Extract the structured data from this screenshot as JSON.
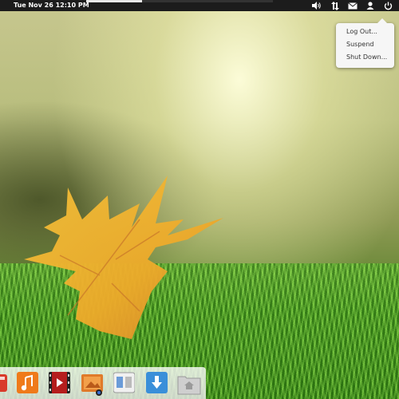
{
  "panel": {
    "clock_text": "Tue Nov 26 12:10 PM",
    "progress": 0.3,
    "indicators": [
      {
        "icon": "volume-icon"
      },
      {
        "icon": "network-icon"
      },
      {
        "icon": "mail-icon"
      },
      {
        "icon": "user-icon"
      },
      {
        "icon": "power-icon"
      }
    ]
  },
  "session_menu": {
    "items": [
      "Log Out...",
      "Suspend",
      "Shut Down..."
    ]
  },
  "dock": {
    "apps": [
      {
        "name": "partial-app-icon",
        "color": "#d93a2a"
      },
      {
        "name": "music-app-icon",
        "color": "#ef7a1a"
      },
      {
        "name": "video-app-icon",
        "color": "#b51d1d"
      },
      {
        "name": "photos-app-icon",
        "color": "#e07a2a"
      },
      {
        "name": "window-manager-icon",
        "color": "#e8e8e8"
      },
      {
        "name": "download-app-icon",
        "color": "#3a8fd9"
      },
      {
        "name": "home-folder-icon",
        "color": "#cfcfcf"
      }
    ]
  },
  "colors": {
    "panel": "#1c1c1c",
    "menu_bg": "#f6f6f6",
    "menu_text": "#333333"
  }
}
